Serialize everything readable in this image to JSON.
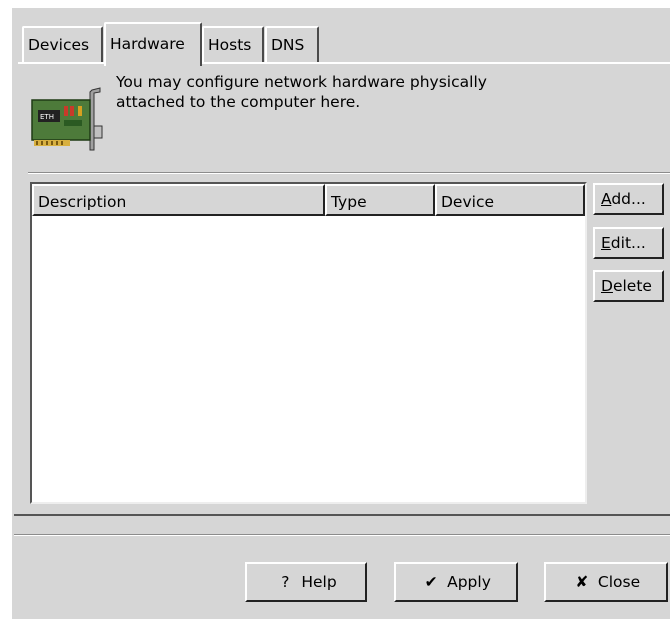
{
  "tabs": [
    {
      "label": "Devices"
    },
    {
      "label": "Hardware"
    },
    {
      "label": "Hosts"
    },
    {
      "label": "DNS"
    }
  ],
  "active_tab": "Hardware",
  "description": {
    "line1": "You may configure network hardware physically",
    "line2": "attached to the computer here."
  },
  "table": {
    "columns": [
      "Description",
      "Type",
      "Device"
    ],
    "rows": []
  },
  "side_buttons": {
    "add": {
      "mnemonic": "A",
      "rest": "dd..."
    },
    "edit": {
      "mnemonic": "E",
      "rest": "dit..."
    },
    "delete": {
      "mnemonic": "D",
      "rest": "elete"
    }
  },
  "footer": {
    "help_label": "Help",
    "apply_label": "Apply",
    "close_label": "Close"
  },
  "icons": {
    "hardware": "network-card-icon",
    "help": "question-mark-icon",
    "apply": "checkmark-icon",
    "close": "x-icon"
  },
  "colors": {
    "window_bg": "#d6d6d6",
    "card_green": "#4d7a3a"
  }
}
